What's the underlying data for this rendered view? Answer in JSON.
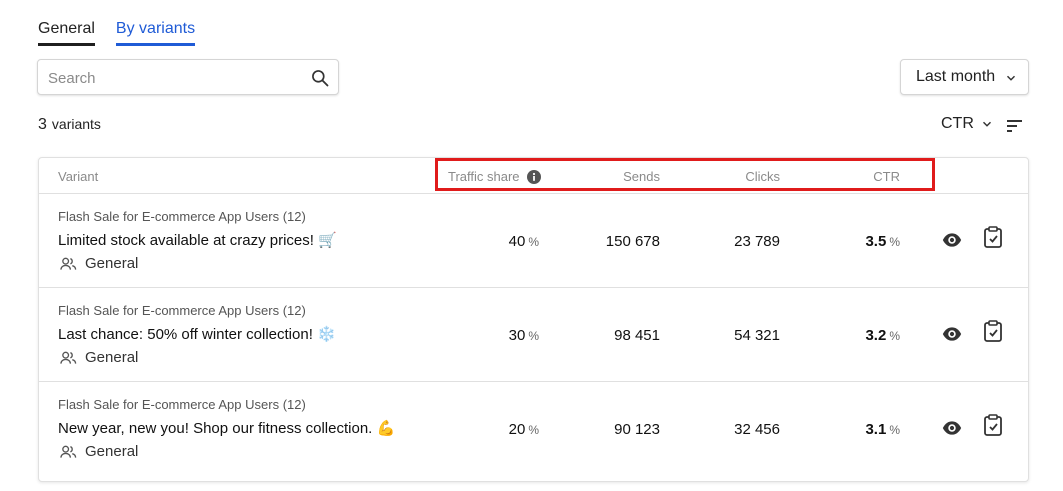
{
  "tabs": [
    {
      "label": "General",
      "active": false
    },
    {
      "label": "By variants",
      "active": true
    }
  ],
  "search": {
    "placeholder": "Search",
    "icon": "search-icon"
  },
  "period": {
    "label": "Last month",
    "icon": "chevron-down-icon"
  },
  "summary": {
    "count": "3",
    "label": "variants"
  },
  "sort": {
    "label": "CTR",
    "icons": [
      "chevron-down-icon",
      "sort-lines-icon"
    ]
  },
  "table": {
    "columns": {
      "variant": "Variant",
      "traffic": "Traffic share",
      "sends": "Sends",
      "clicks": "Clicks",
      "ctr": "CTR"
    },
    "unit": "%",
    "rows": [
      {
        "campaign": "Flash Sale for E-commerce App Users (12)",
        "title": "Limited stock available at crazy prices! 🛒",
        "segment": "General",
        "traffic": "40",
        "sends": "150 678",
        "clicks": "23 789",
        "ctr": "3.5"
      },
      {
        "campaign": "Flash Sale for E-commerce App Users (12)",
        "title": "Last chance: 50% off winter collection! ❄️",
        "segment": "General",
        "traffic": "30",
        "sends": "98 451",
        "clicks": "54 321",
        "ctr": "3.2"
      },
      {
        "campaign": "Flash Sale for E-commerce App Users (12)",
        "title": "New year, new you! Shop our fitness collection. 💪",
        "segment": "General",
        "traffic": "20",
        "sends": "90 123",
        "clicks": "32 456",
        "ctr": "3.1"
      }
    ]
  },
  "colors": {
    "accent": "#1f5bd6",
    "highlight": "#e01b1b",
    "border": "#e0e0e0"
  }
}
